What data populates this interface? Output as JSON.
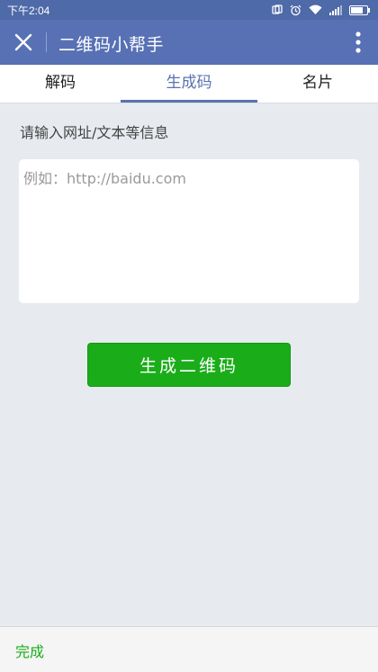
{
  "status_bar": {
    "time": "下午2:04",
    "icons": [
      "nfc-icon",
      "alarm-icon",
      "wifi-icon",
      "signal-icon",
      "battery-icon"
    ]
  },
  "app_bar": {
    "title": "二维码小帮手",
    "close_icon": "close-icon",
    "more_icon": "more-vertical-icon"
  },
  "tabs": [
    {
      "label": "解码",
      "active": false
    },
    {
      "label": "生成码",
      "active": true
    },
    {
      "label": "名片",
      "active": false
    }
  ],
  "form": {
    "label": "请输入网址/文本等信息",
    "input_value": "",
    "input_placeholder": "例如：http://baidu.com",
    "submit_label": "生成二维码"
  },
  "bottom_bar": {
    "done_label": "完成"
  },
  "colors": {
    "status_bar": "#4f6aa8",
    "app_bar": "#5771b4",
    "accent_tab": "#5a72b0",
    "primary_button": "#1aad19",
    "background": "#e7ebef"
  }
}
